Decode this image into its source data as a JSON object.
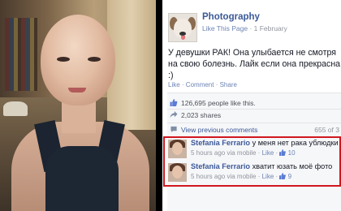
{
  "post": {
    "page_name": "Photography",
    "like_page": "Like This Page",
    "separator": " · ",
    "date": "1 February",
    "text": "У девушки РАК! Она улыбается не смотря на свою болезнь. Лайк если она прекрасна :)",
    "like_action": "Like",
    "comment_action": "Comment",
    "share_action": "Share"
  },
  "stats": {
    "likes": "126,695 people like this.",
    "shares": "2,023 shares",
    "view_previous": "View previous comments",
    "comment_count": "655 of 3"
  },
  "comments": [
    {
      "author": "Stefania Ferrario",
      "text": "у меня нет рака ублюдки",
      "time": "5 hours ago via mobile",
      "like": "Like",
      "likes": "10"
    },
    {
      "author": "Stefania Ferrario",
      "text": "хватит юзать моё фото",
      "time": "5 hours ago via mobile",
      "like": "Like",
      "likes": "9"
    }
  ],
  "colors": {
    "link": "#3b5998",
    "highlight": "#d0171e",
    "meta": "#90949c"
  },
  "icons": [
    "thumbs-up-icon",
    "share-icon",
    "comment-bubble-icon"
  ]
}
